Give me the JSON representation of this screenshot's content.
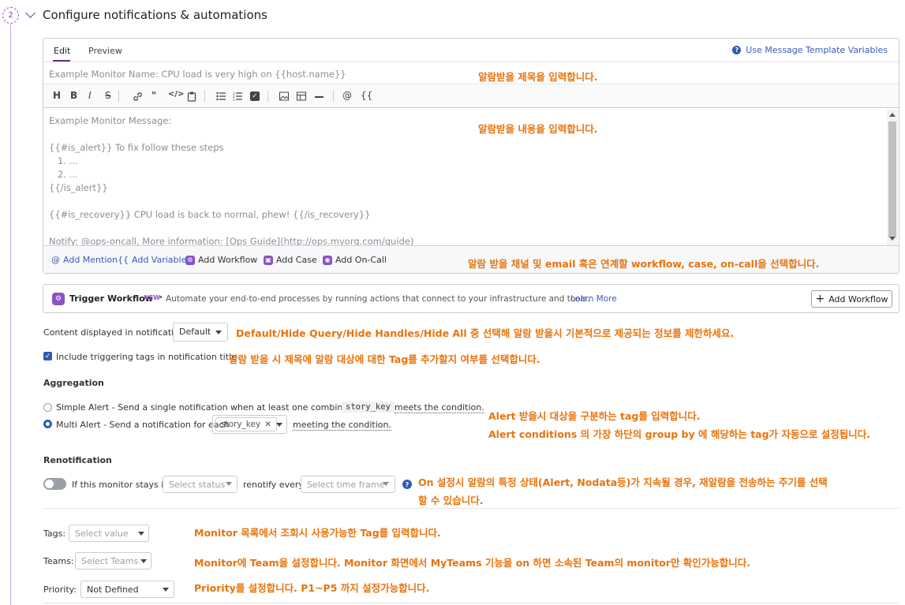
{
  "step": {
    "number": "2",
    "title": "Configure notifications & automations"
  },
  "editor": {
    "tabs": [
      {
        "label": "Edit"
      },
      {
        "label": "Preview"
      }
    ],
    "template_link": "Use Message Template Variables",
    "name_placeholder": "Example Monitor Name: CPU load is very high on {{host.name}}",
    "toolbar": [
      "H",
      "B",
      "I",
      "S",
      "link-icon",
      "quote-icon",
      "code-icon",
      "paste-icon",
      "bullet-list-icon",
      "numbered-list-icon",
      "checkbox-icon",
      "image-icon",
      "table-icon",
      "hr-icon",
      "@",
      "{{"
    ],
    "message_lines": [
      "Example Monitor Message:",
      "",
      "{{#is_alert}} To fix follow these steps",
      "   1. ...",
      "   2. ...",
      "{{/is_alert}}",
      "",
      "{{#is_recovery}} CPU load is back to normal, phew! {{/is_recovery}}",
      "",
      "Notify: @ops-oncall, More information: [Ops Guide](http://ops.myorg.com/guide)"
    ],
    "bottom_actions": {
      "add_mention": "Add Mention",
      "add_variable": "Add Variable",
      "add_workflow": "Add Workflow",
      "add_case": "Add Case",
      "add_oncall": "Add On-Call"
    }
  },
  "workflow": {
    "title": "Trigger Workflow",
    "badge": "NEW",
    "separator": "•",
    "description": "Automate your end-to-end processes by running actions that connect to your infrastructure and tools.",
    "learn_more": "Learn More",
    "button": "Add Workflow"
  },
  "content_display": {
    "label": "Content displayed in notification",
    "value": "Default"
  },
  "include_tags": {
    "label": "Include triggering tags in notification title",
    "checked": true
  },
  "aggregation": {
    "title": "Aggregation",
    "simple": {
      "label": "Simple Alert - Send a single notification when at least one combination of",
      "code": "story_key",
      "suffix": "meets the condition."
    },
    "multi": {
      "label": "Multi Alert - Send a notification for each",
      "chip": "story_key",
      "suffix": "meeting the condition."
    }
  },
  "renotification": {
    "title": "Renotification",
    "prefix": "If this monitor stays in",
    "status_placeholder": "Select status",
    "middle": "renotify every",
    "timeframe_placeholder": "Select time frame"
  },
  "tags": {
    "label": "Tags:",
    "placeholder": "Select value"
  },
  "teams": {
    "label": "Teams:",
    "placeholder": "Select Teams"
  },
  "priority": {
    "label": "Priority:",
    "value": "Not Defined"
  },
  "annotations": {
    "title": "알람받을 제목을 입력합니다.",
    "message": "알람받을 내용을 입력합니다.",
    "channels": "알람 받을 채널 및 email 혹은 연계할 workflow, case, on-call을 선택합니다.",
    "content": "Default/Hide Query/Hide Handles/Hide All 중 선택해 알람 받을시 기본적으로 제공되는 정보를 제한하세요.",
    "tags_title": "알람 받을 시 제목에 알람 대상에 대한 Tag를 추가할지 여부를 선택합니다.",
    "alert_tag_1": "Alert 받을시 대상을 구분하는 tag를 입력합니다.",
    "alert_tag_2": "Alert conditions 의 가장 하단의 group by 에 해당하는 tag가 자동으로 설정됩니다.",
    "renotify_1": "On 설정시 알람의 특정 상태(Alert, Nodata등)가 지속될 경우, 재알람을 전송하는 주기를 선택",
    "renotify_2": "할 수 있습니다.",
    "tags_note": "Monitor 목록에서 조회시 사용가능한 Tag를 입력합니다.",
    "teams_note": "Monitor에 Team을 설정합니다. Monitor 화면에서 MyTeams 기능을 on 하면 소속된 Team의 monitor만 확인가능합니다.",
    "priority_note": "Priority를 설정합니다. P1~P5 까지 설정가능합니다."
  },
  "colors": {
    "accent": "#632ca6",
    "link": "#3b5bb8",
    "annotation": "#e8730c"
  }
}
